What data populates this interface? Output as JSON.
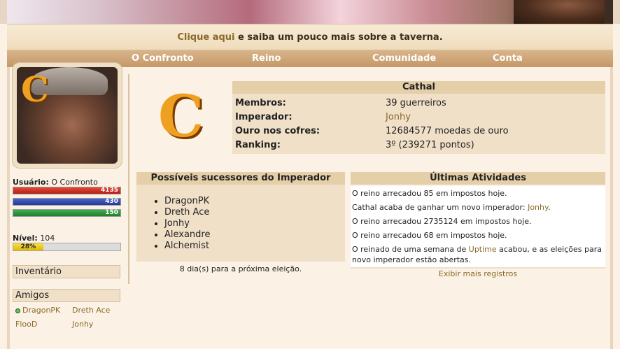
{
  "banner": {
    "taverna_link": "Clique aqui",
    "taverna_text": " e saiba um pouco mais sobre a taverna."
  },
  "nav": {
    "items": [
      "O Confronto",
      "Reino",
      "Comunidade",
      "Conta"
    ]
  },
  "sidebar": {
    "usuario_label": "Usuário:",
    "usuario_value": "O Confronto",
    "bars": {
      "red": "4135",
      "blue": "430",
      "green": "150"
    },
    "nivel_label": "Nível:",
    "nivel_value": "104",
    "xp_percent": "28%",
    "xp_fraction": 0.28,
    "inventario": "Inventário",
    "amigos": "Amigos",
    "friends": [
      "DragonPK",
      "Dreth Ace",
      "FlooD",
      "Jonhy"
    ]
  },
  "kingdom": {
    "emblem": "C",
    "name": "Cathal",
    "rows": [
      {
        "key": "Membros:",
        "value": "39 guerreiros"
      },
      {
        "key": "Imperador:",
        "value": "Jonhy"
      },
      {
        "key": "Ouro nos cofres:",
        "value": "12684577 moedas de ouro"
      },
      {
        "key": "Ranking:",
        "value": "3º (239271 pontos)"
      }
    ]
  },
  "successors": {
    "title": "Possíveis sucessores do Imperador",
    "names": [
      "DragonPK",
      "Dreth Ace",
      "Jonhy",
      "Alexandre",
      "Alchemist"
    ],
    "election": "8 dia(s) para a próxima eleição."
  },
  "activities": {
    "title": "Últimas Atividades",
    "row1": "O reino arrecadou 85 em impostos hoje.",
    "row2_pre": "Cathal acaba de ganhar um novo imperador: ",
    "row2_link": "Jonhy",
    "row2_post": ".",
    "row3": "O reino arrecadou 2735124 em impostos hoje.",
    "row4": "O reino arrecadou 68 em impostos hoje.",
    "row5_pre": "O reinado de uma semana de ",
    "row5_link": "Uptime",
    "row5_post": " acabou, e as eleições para novo imperador estão abertas.",
    "more": "Exibir mais registros"
  },
  "colors": {
    "accent": "#8a6a2a",
    "panel": "#f0e0c8",
    "header": "#e5cfa9",
    "nav": "#c49868"
  }
}
